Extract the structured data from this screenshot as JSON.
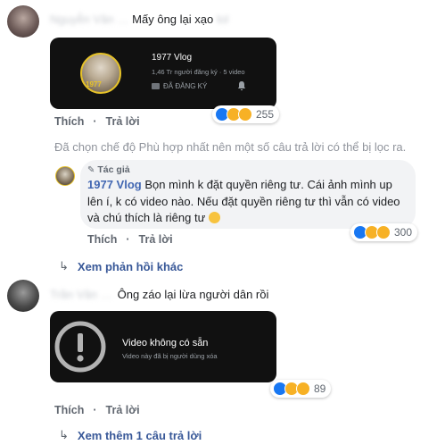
{
  "comment1": {
    "blurred_name": "Nguyễn Văn …",
    "text": "Mấy ông lại xạo",
    "blurred_tail": "lol",
    "card": {
      "channel_name": "1977 Vlog",
      "subscribers": "1,46 Tr người đăng ký · 5 video",
      "subscribed_label": "ĐÃ ĐĂNG KÝ",
      "avatar_text": "1977"
    },
    "actions": {
      "like": "Thích",
      "reply": "Trả lời"
    },
    "reaction_count": "255"
  },
  "filter_notice": "Đã chọn chế độ Phù hợp nhất nên một số câu trả lời có thể bị lọc ra.",
  "reply1": {
    "author_badge": "Tác giả",
    "author_name": "1977 Vlog",
    "line1": "Bọn mình k đặt quyền riêng tư. Cái ảnh mình up",
    "line2": "lên í, k có video nào. Nếu đặt quyền riêng tư thì vẫn có video",
    "line3": "và chú thích là riêng tư",
    "actions": {
      "like": "Thích",
      "reply": "Trả lời"
    },
    "reaction_count": "300"
  },
  "more_replies_1": "Xem phản hồi khác",
  "comment2": {
    "blurred_name": "Trần Văn …",
    "text": "Ông záo lại lừa người dân rồi",
    "card": {
      "title": "Video không có sẵn",
      "subtitle": "Video này đã bị người dùng xóa"
    },
    "actions": {
      "like": "Thích",
      "reply": "Trả lời"
    },
    "reaction_count": "89"
  },
  "more_replies_2": "Xem thêm 1 câu trả lời",
  "colors": {
    "link": "#385898",
    "like": "#1877f2",
    "bubble": "#f2f3f5",
    "card": "#111111"
  }
}
